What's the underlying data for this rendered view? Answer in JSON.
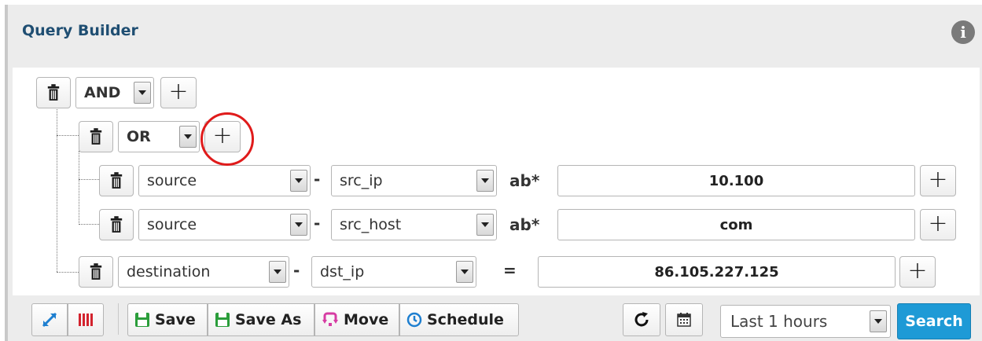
{
  "panel": {
    "title": "Query Builder",
    "info_icon": "info-circle-icon"
  },
  "root_group": {
    "operator": "AND",
    "icons": {
      "delete": "trash-icon",
      "add": "plus-icon"
    }
  },
  "sub_group": {
    "operator": "OR",
    "highlight_color": "#e01b1b"
  },
  "rules": [
    {
      "category": "source",
      "field": "src_ip",
      "separator": "-",
      "operator": "ab*",
      "value": "10.100"
    },
    {
      "category": "source",
      "field": "src_host",
      "separator": "-",
      "operator": "ab*",
      "value": "com"
    },
    {
      "category": "destination",
      "field": "dst_ip",
      "separator": "-",
      "operator": "=",
      "value": "86.105.227.125"
    }
  ],
  "toolbar": {
    "expand_icon": "expand-arrows-icon",
    "columns_icon": "columns-icon",
    "save_label": "Save",
    "save_as_label": "Save As",
    "move_label": "Move",
    "schedule_label": "Schedule",
    "refresh_icon": "refresh-icon",
    "calendar_icon": "calendar-icon",
    "period_value": "Last 1 hours",
    "search_label": "Search",
    "accent_color": "#1e9ad6"
  }
}
